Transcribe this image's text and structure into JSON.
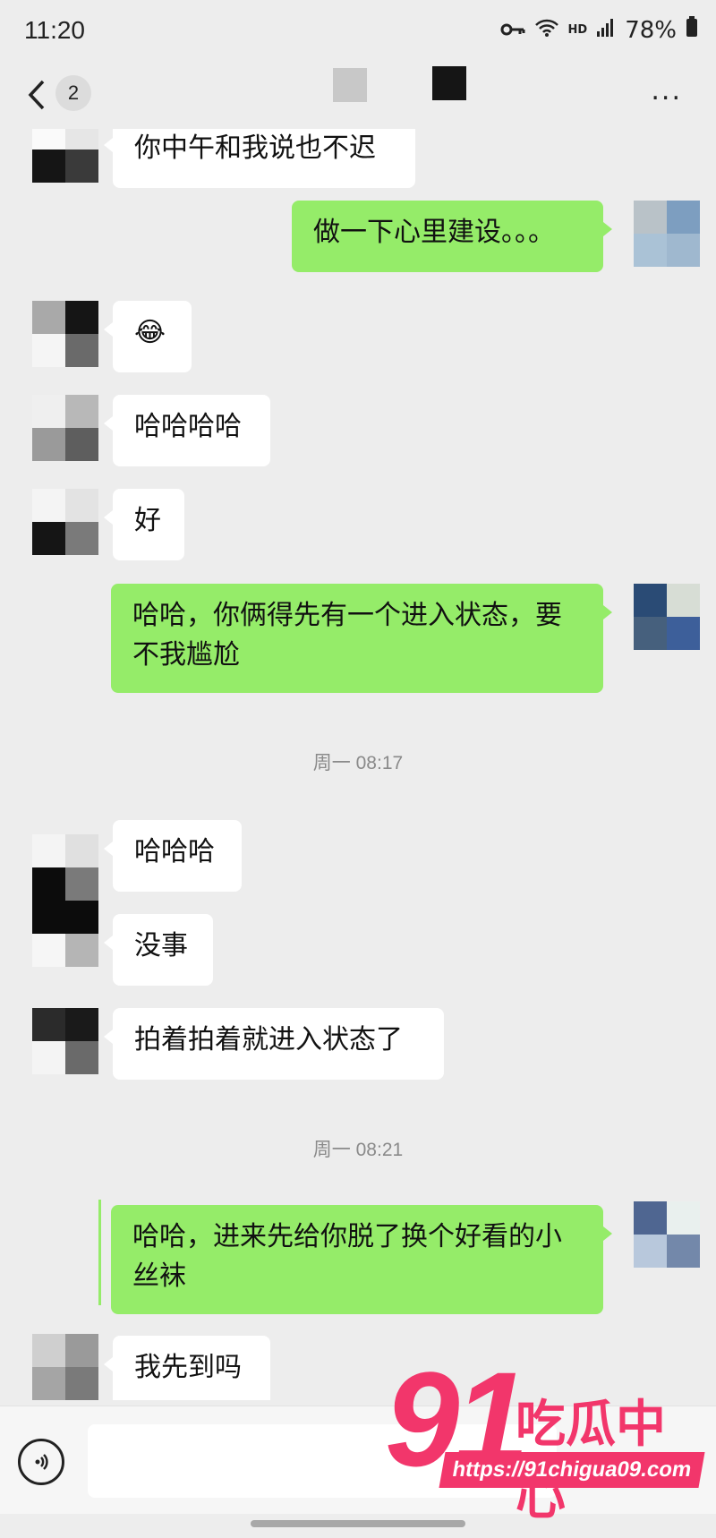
{
  "status_bar": {
    "time": "11:20",
    "hd": "HD",
    "battery": "78%"
  },
  "header": {
    "unread_count": "2",
    "more": "..."
  },
  "messages": [
    {
      "side": "in",
      "text": "你中午和我说也不迟"
    },
    {
      "side": "out",
      "text": "做一下心里建设。。。"
    },
    {
      "side": "in",
      "text": "😂"
    },
    {
      "side": "in",
      "text": "哈哈哈哈"
    },
    {
      "side": "in",
      "text": "好"
    },
    {
      "side": "out",
      "text": "哈哈，你俩得先有一个进入状态，要不我尴尬"
    },
    {
      "side": "in",
      "text": "哈哈哈"
    },
    {
      "side": "in",
      "text": "没事"
    },
    {
      "side": "in",
      "text": "拍着拍着就进入状态了"
    },
    {
      "side": "out",
      "text": "哈哈，进来先给你脱了换个好看的小丝袜"
    },
    {
      "side": "in",
      "text": "我先到吗"
    }
  ],
  "timestamps": [
    "周一 08:17",
    "周一 08:21"
  ],
  "watermark": {
    "number": "91",
    "name": "吃瓜中心",
    "url": "https://91chigua09.com"
  }
}
